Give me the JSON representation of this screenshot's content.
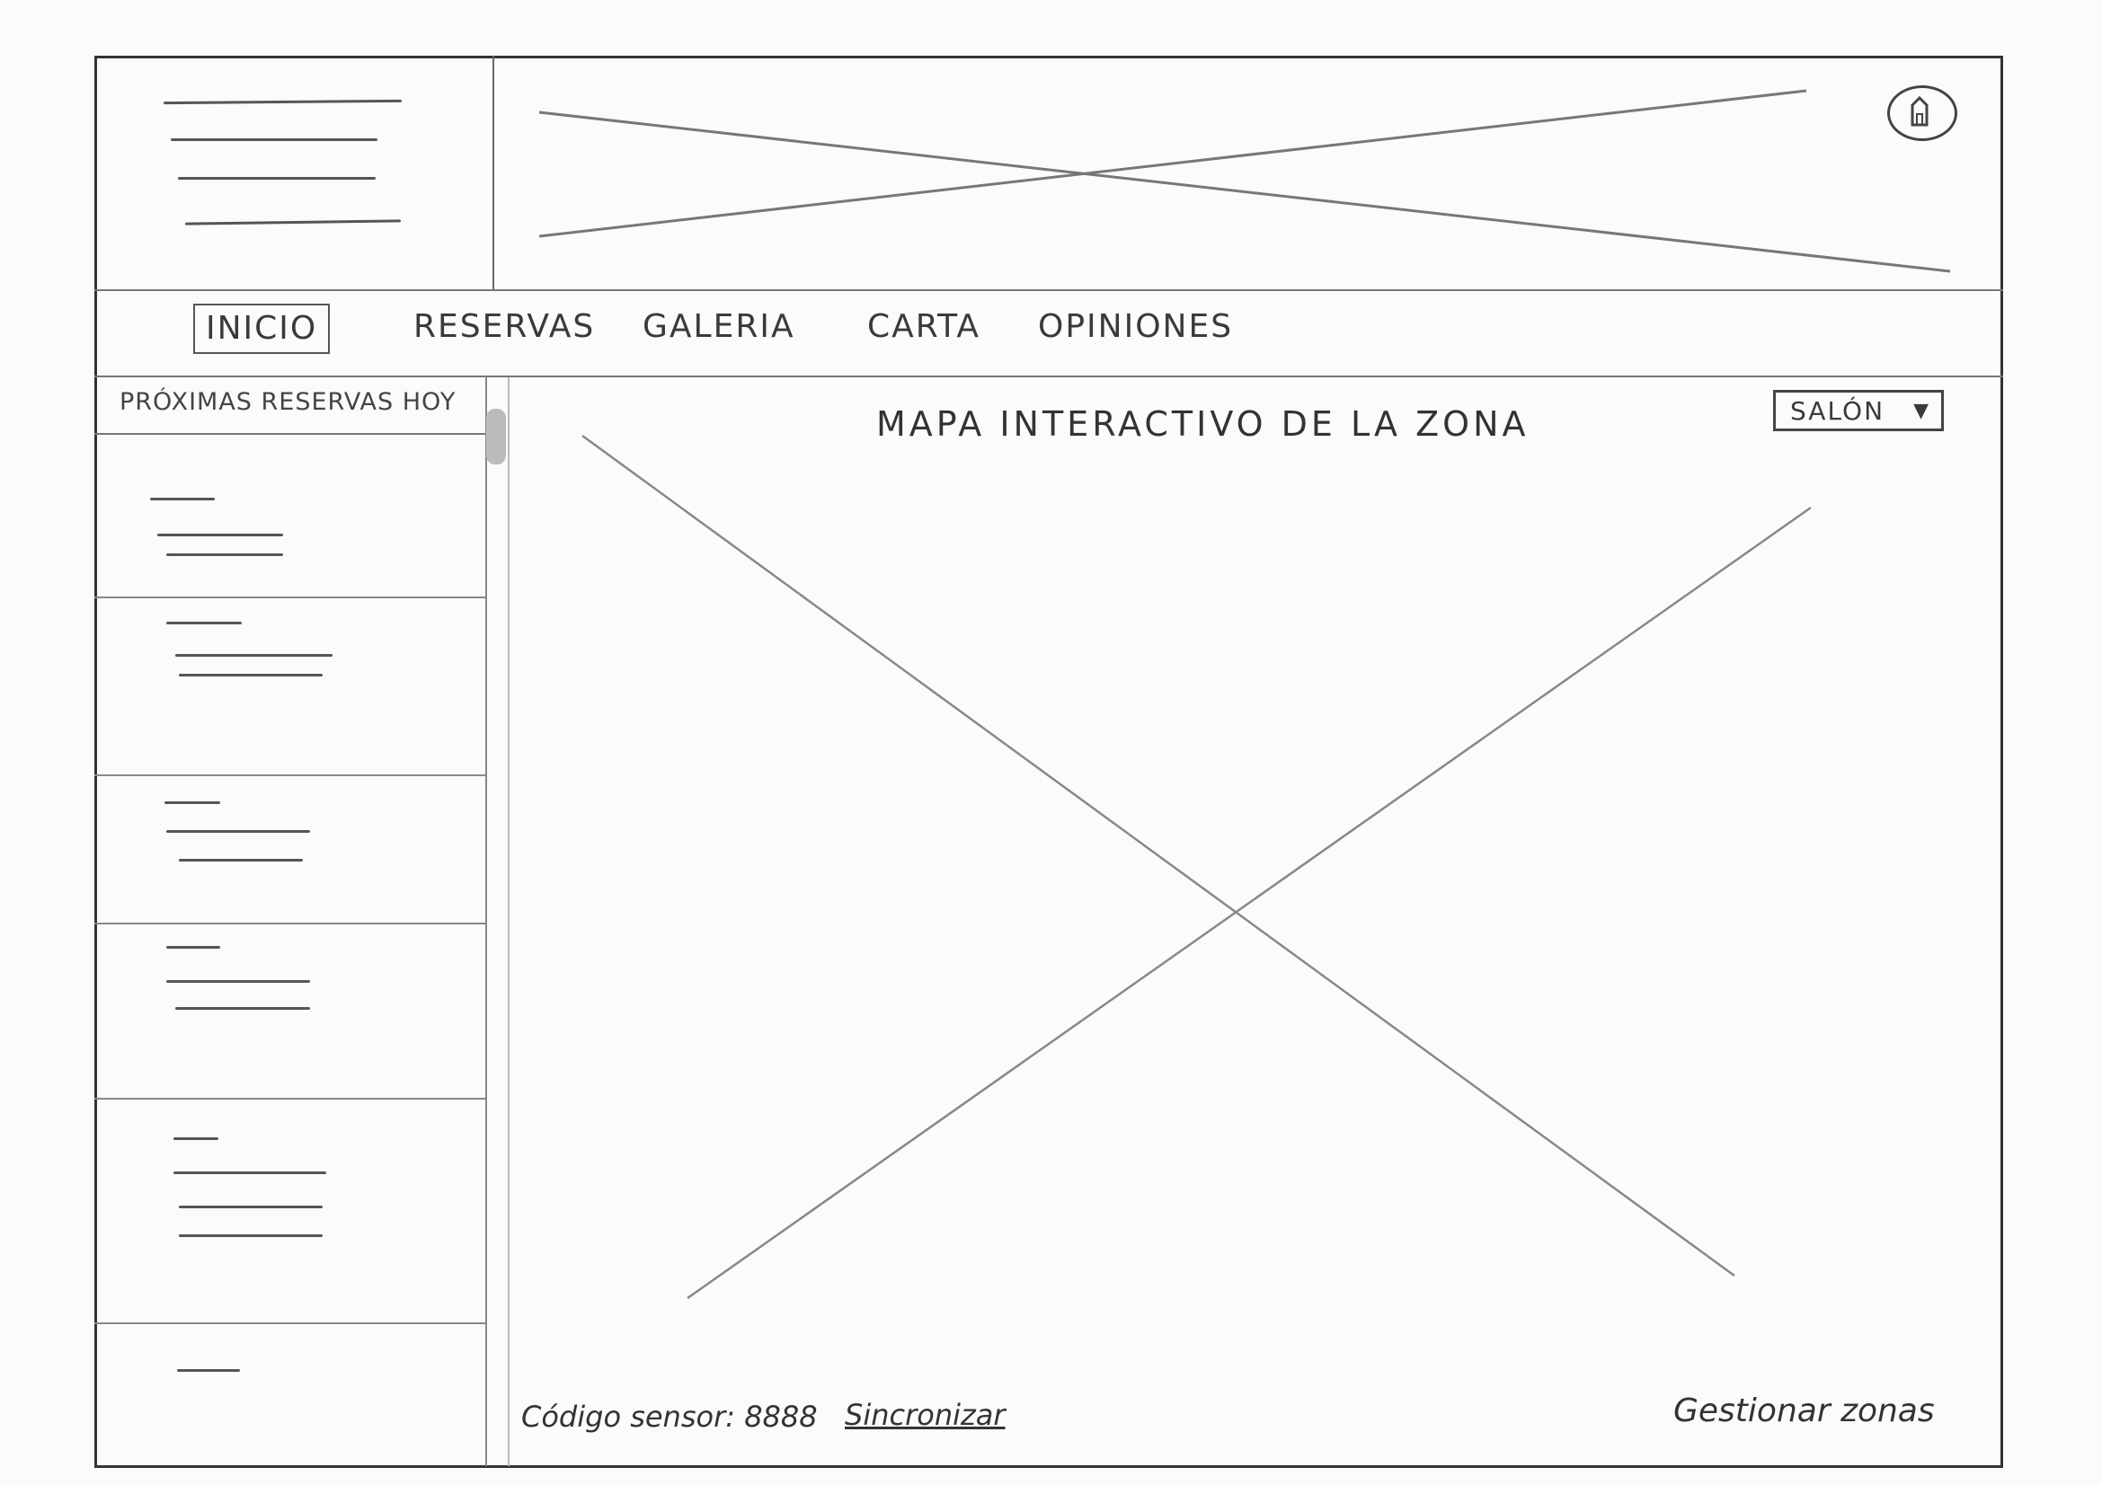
{
  "nav": {
    "items": [
      {
        "label": "INICIO",
        "active": true
      },
      {
        "label": "RESERVAS",
        "active": false
      },
      {
        "label": "GALERIA",
        "active": false
      },
      {
        "label": "CARTA",
        "active": false
      },
      {
        "label": "OPINIONES",
        "active": false
      }
    ]
  },
  "header": {
    "menu_icon": "hamburger-lines",
    "banner": "image-placeholder",
    "account_icon": "home-icon"
  },
  "sidebar": {
    "title": "PRÓXIMAS RESERVAS HOY",
    "items_count_visible": 6
  },
  "main": {
    "title": "MAPA INTERACTIVO DE LA ZONA",
    "zone_select": {
      "selected": "SALÓN"
    },
    "map": "image-placeholder"
  },
  "footer": {
    "sensor_label": "Código sensor: 8888",
    "sync_link": "Sincronizar",
    "manage_link": "Gestionar zonas"
  }
}
